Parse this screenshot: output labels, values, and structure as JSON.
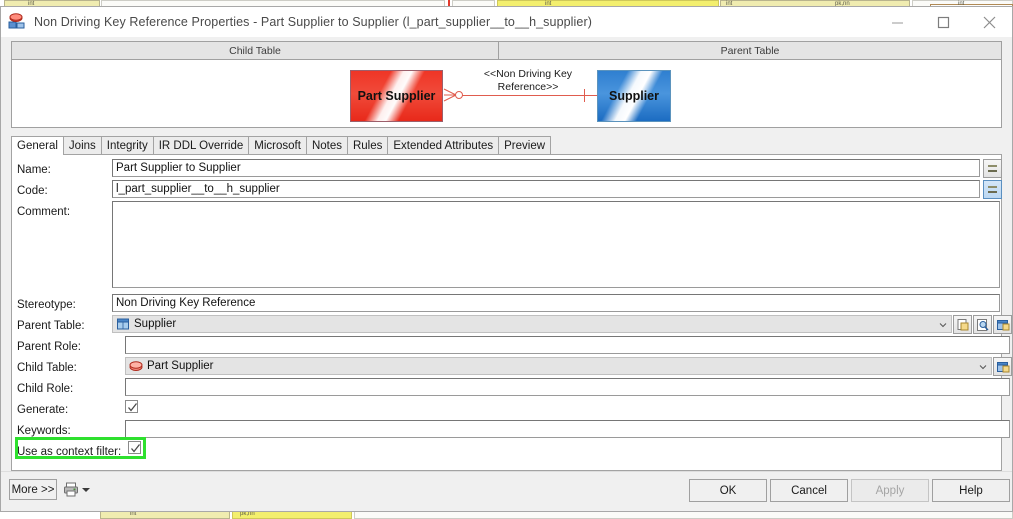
{
  "window": {
    "title": "Non Driving Key Reference Properties - Part Supplier  to  Supplier (l_part_supplier__to__h_supplier)",
    "icon": "reference-icon",
    "minimize_label": "Minimize",
    "maximize_label": "Maximize",
    "close_label": "Close"
  },
  "panels": {
    "child_header": "Child Table",
    "parent_header": "Parent Table"
  },
  "diagram": {
    "child_entity": "Part Supplier",
    "parent_entity": "Supplier",
    "relationship_label": "<<Non Driving Key Reference>>",
    "child_color": "#ef3526",
    "parent_color": "#2f7fd0",
    "connector_color": "#e05c4e"
  },
  "tabs": [
    {
      "label": "General",
      "active": true
    },
    {
      "label": "Joins",
      "active": false
    },
    {
      "label": "Integrity",
      "active": false
    },
    {
      "label": "IR DDL Override",
      "active": false
    },
    {
      "label": "Microsoft",
      "active": false
    },
    {
      "label": "Notes",
      "active": false
    },
    {
      "label": "Rules",
      "active": false
    },
    {
      "label": "Extended Attributes",
      "active": false
    },
    {
      "label": "Preview",
      "active": false
    }
  ],
  "form": {
    "name_label": "Name:",
    "name_value": "Part Supplier  to  Supplier",
    "code_label": "Code:",
    "code_value": "l_part_supplier__to__h_supplier",
    "comment_label": "Comment:",
    "comment_value": "",
    "stereotype_label": "Stereotype:",
    "stereotype_value": "Non Driving Key Reference",
    "parent_table_label": "Parent Table:",
    "parent_table_value": "Supplier",
    "parent_role_label": "Parent Role:",
    "parent_role_value": "",
    "child_table_label": "Child Table:",
    "child_table_value": "Part Supplier",
    "child_role_label": "Child Role:",
    "child_role_value": "",
    "generate_label": "Generate:",
    "generate_checked": true,
    "keywords_label": "Keywords:",
    "keywords_value": "",
    "context_filter_label": "Use as context filter:",
    "context_filter_checked": true,
    "equals_button_label": "=",
    "parent_create_button": "create-object-button",
    "parent_browse_button": "browse-object-button",
    "parent_properties_button": "object-properties-button",
    "child_properties_button": "object-properties-button",
    "highlight_color": "#2ee02e"
  },
  "footer": {
    "more_label": "More >>",
    "print_label": "print-icon",
    "ok_label": "OK",
    "cancel_label": "Cancel",
    "apply_label": "Apply",
    "apply_disabled": true,
    "help_label": "Help"
  }
}
